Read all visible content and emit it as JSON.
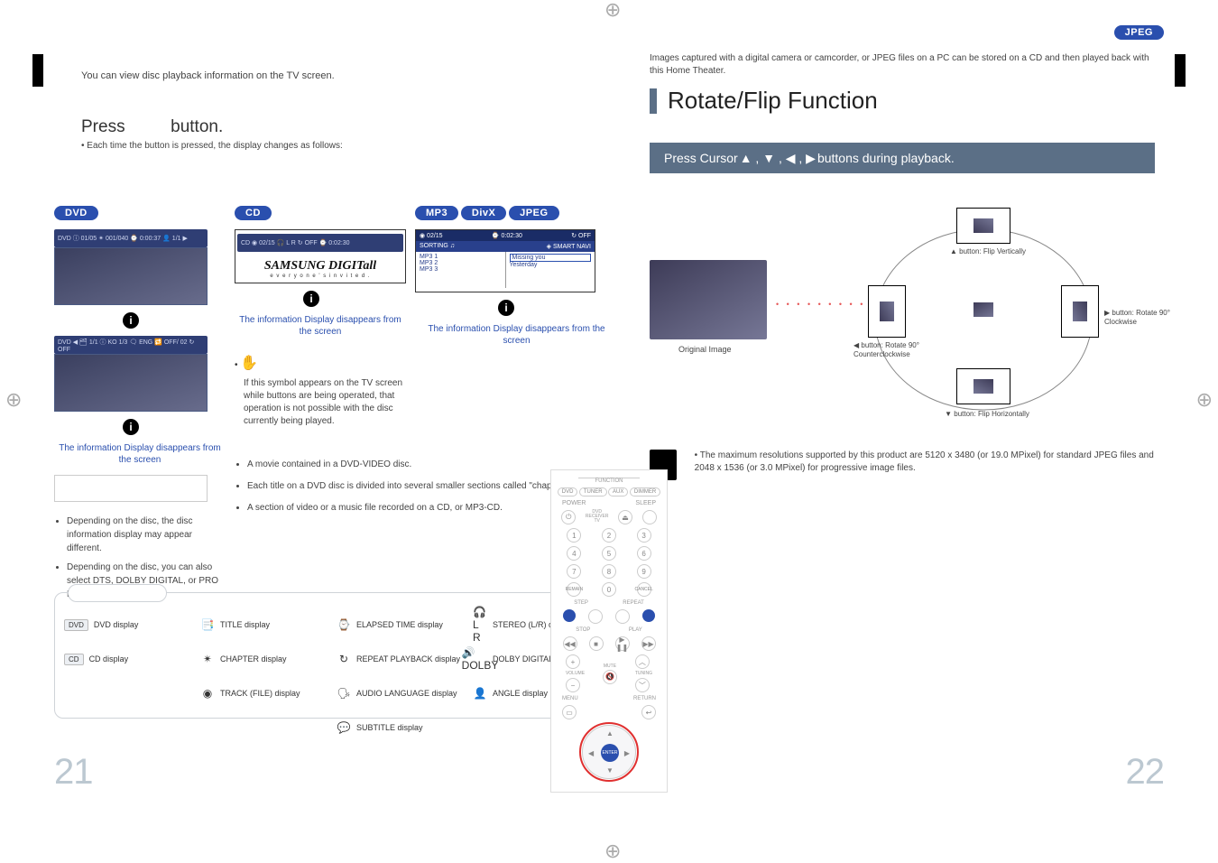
{
  "domain": "Document",
  "page_numbers": {
    "left": "21",
    "right": "22"
  },
  "left": {
    "intro": "You can view disc playback information  on the TV screen.",
    "press_prefix": "Press",
    "press_suffix": "button.",
    "press_sub": "•  Each time the button is pressed, the display changes as follows:",
    "pills": {
      "dvd": "DVD",
      "cd": "CD",
      "mp3": "MP3",
      "divx": "DivX",
      "jpeg": "JPEG"
    },
    "osd_dvd": {
      "line": "DVD ◀ 🗂 1/1 ⓘ KO 1/3  🗨 ENG  🔁 OFF/ 02   ↻ OFF"
    },
    "osd_cd": {
      "line": "CD   ◉ 02/15   🎧 L R   ↻ OFF   ⌚ 0:02:30"
    },
    "samsung_brand": "SAMSUNG DIGITall",
    "samsung_tag": "e v e r y o n e ' s   i n v i t e d .",
    "mp3_screen": {
      "top_l": "◉ 02/15",
      "top_c": "⌚ 0:02:30",
      "top_r": "↻ OFF",
      "row2_l": "SORTING  ♫",
      "row2_r": "◈ SMART NAVI",
      "col1": [
        "MP3 1",
        "MP3 2",
        "MP3 3"
      ],
      "col2_hilite": "Missing you",
      "col2": [
        "Yesterday"
      ]
    },
    "info_text": "The information Display disappears from the screen",
    "hand_note": "If this symbol appears on the TV screen while buttons are being operated, that operation is not possible with the disc currently being played.",
    "bullets_col1": [
      "Depending on the disc, the disc information display may appear different.",
      "Depending on the disc, you can also select DTS, DOLBY DIGITAL, or PRO LOGIC."
    ],
    "defs": [
      {
        "title": "",
        "body": "A movie contained in a DVD-VIDEO disc."
      },
      {
        "title": "",
        "body": "Each title on a DVD disc is divided into several smaller sections called \"chapters\"."
      },
      {
        "title": "",
        "body": "A section of video or a music file recorded on a CD, or MP3-CD."
      }
    ],
    "legend": {
      "items": [
        {
          "prefix_tag": "DVD",
          "text": "DVD display"
        },
        {
          "icon": "📑",
          "text": "TITLE display"
        },
        {
          "icon": "⌚",
          "text": "ELAPSED TIME display"
        },
        {
          "icon": "🎧 L R",
          "text": "STEREO (L/R) display"
        },
        {
          "prefix_tag": "CD",
          "text": "CD display"
        },
        {
          "icon": "✴",
          "text": "CHAPTER display"
        },
        {
          "icon": "↻",
          "text": "REPEAT PLAYBACK display"
        },
        {
          "icon": "🔊 DOLBY",
          "text": "DOLBY DIGITAL display"
        },
        {
          "blank": true
        },
        {
          "icon": "◉",
          "text": "TRACK (FILE) display"
        },
        {
          "icon": "🗣",
          "text": "AUDIO LANGUAGE display"
        },
        {
          "icon": "👤",
          "text": "ANGLE display"
        },
        {
          "blank": true
        },
        {
          "blank": true
        },
        {
          "icon": "💬",
          "text": "SUBTITLE display"
        },
        {
          "blank": true
        }
      ]
    }
  },
  "right": {
    "jpeg_pill": "JPEG",
    "intro": "Images captured with a digital camera or camcorder, or JPEG files on a PC can be stored on a CD and then played back with this Home Theater.",
    "heading": "Rotate/Flip Function",
    "blue_bar_prefix": "Press Cursor  ",
    "blue_bar_arrows": "▲ , ▼ , ◀ , ▶",
    "blue_bar_suffix": "  buttons during playback.",
    "labels": {
      "orig": "Original Image",
      "up": "▲ button: Flip Vertically",
      "left": "◀ button: Rotate 90° Counterclockwise",
      "right": "▶ button: Rotate 90° Clockwise",
      "down": "▼ button: Flip Horizontally"
    },
    "note": "•  The maximum resolutions supported by this product are 5120 x 3480 (or 19.0 MPixel) for standard JPEG files and 2048 x 1536 (or 3.0 MPixel) for progressive image files.",
    "remote": {
      "func_row": [
        "DVD",
        "TUNER",
        "AUX",
        "DIMMER"
      ],
      "power": "POWER",
      "sleep": "SLEEP",
      "labels_row": [
        "REMAIN",
        "CANCEL"
      ],
      "labels2": [
        "STEP",
        "REPEAT",
        "STOP",
        "PLAY",
        "MUTE",
        "VOLUME",
        "TUNING",
        "MENU",
        "RETURN"
      ],
      "enter": "ENTER"
    }
  }
}
